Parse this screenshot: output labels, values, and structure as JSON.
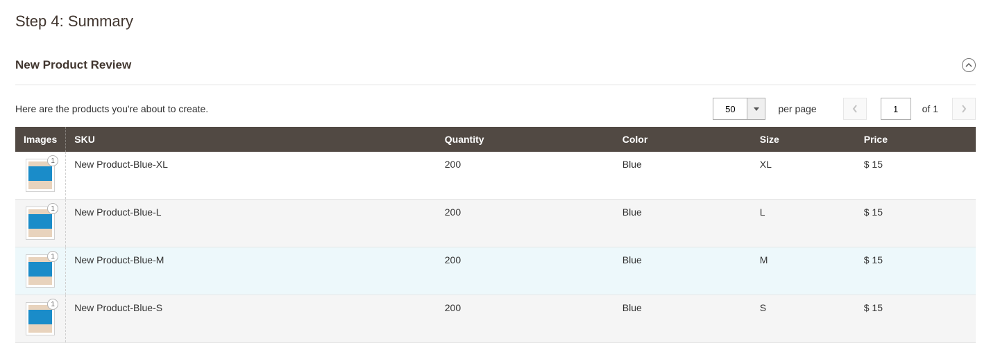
{
  "page": {
    "step_title": "Step 4: Summary",
    "section_title": "New Product Review",
    "intro_text": "Here are the products you're about to create."
  },
  "pager": {
    "per_page": "50",
    "per_page_label": "per page",
    "current_page": "1",
    "of_label": "of 1"
  },
  "table": {
    "headers": {
      "images": "Images",
      "sku": "SKU",
      "quantity": "Quantity",
      "color": "Color",
      "size": "Size",
      "price": "Price"
    },
    "rows": [
      {
        "badge": "1",
        "sku": "New Product-Blue-XL",
        "quantity": "200",
        "color": "Blue",
        "size": "XL",
        "price": "$ 15"
      },
      {
        "badge": "1",
        "sku": "New Product-Blue-L",
        "quantity": "200",
        "color": "Blue",
        "size": "L",
        "price": "$ 15"
      },
      {
        "badge": "1",
        "sku": "New Product-Blue-M",
        "quantity": "200",
        "color": "Blue",
        "size": "M",
        "price": "$ 15"
      },
      {
        "badge": "1",
        "sku": "New Product-Blue-S",
        "quantity": "200",
        "color": "Blue",
        "size": "S",
        "price": "$ 15"
      }
    ]
  }
}
